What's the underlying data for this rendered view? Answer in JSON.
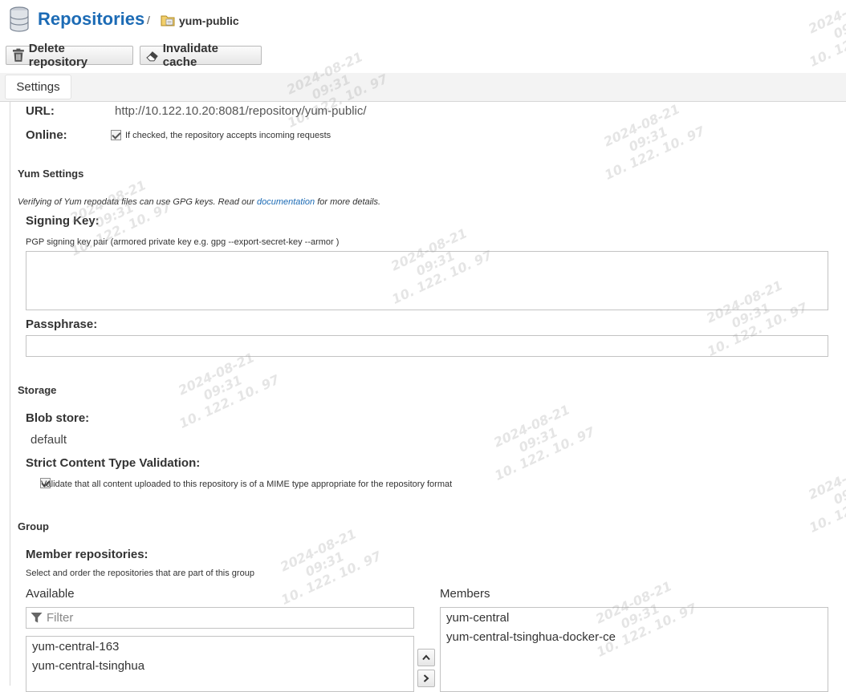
{
  "header": {
    "title": "Repositories",
    "separator": "/",
    "breadcrumb": "yum-public"
  },
  "toolbar": {
    "delete_label": "Delete repository",
    "invalidate_label": "Invalidate cache"
  },
  "tabs": [
    {
      "label": "Settings"
    }
  ],
  "settings": {
    "url_label": "URL:",
    "url_value": "http://10.122.10.20:8081/repository/yum-public/",
    "online_label": "Online:",
    "online_checked": true,
    "online_help": "If checked, the repository accepts incoming requests"
  },
  "yum": {
    "section": "Yum Settings",
    "note_prefix": "Verifying of Yum repodata files can use GPG keys. Read our ",
    "note_link": "documentation",
    "note_suffix": " for more details.",
    "signing_key_label": "Signing Key:",
    "signing_key_help": "PGP signing key pair (armored private key e.g. gpg --export-secret-key --armor )",
    "signing_key_value": "",
    "passphrase_label": "Passphrase:",
    "passphrase_value": ""
  },
  "storage": {
    "section": "Storage",
    "blob_label": "Blob store:",
    "blob_value": "default",
    "strict_label": "Strict Content Type Validation:",
    "strict_checked": true,
    "strict_help": "Validate that all content uploaded to this repository is of a MIME type appropriate for the repository format"
  },
  "group": {
    "section": "Group",
    "members_label": "Member repositories:",
    "members_help": "Select and order the repositories that are part of this group",
    "available_label": "Available",
    "filter_placeholder": "Filter",
    "available": [
      "yum-central-163",
      "yum-central-tsinghua"
    ],
    "members_title": "Members",
    "members": [
      "yum-central",
      "yum-central-tsinghua-docker-ce"
    ]
  },
  "watermark": {
    "date": "2024-08-21",
    "time": "09:31",
    "ip": "10. 122. 10. 97"
  },
  "colors": {
    "accent": "#1c6bb5",
    "tabbar": "#f3f3f3"
  },
  "icons": [
    "database-icon",
    "folder-repo-icon",
    "trash-icon",
    "eraser-icon",
    "check-icon",
    "filter-icon",
    "chevron-up-icon",
    "chevron-right-icon"
  ]
}
